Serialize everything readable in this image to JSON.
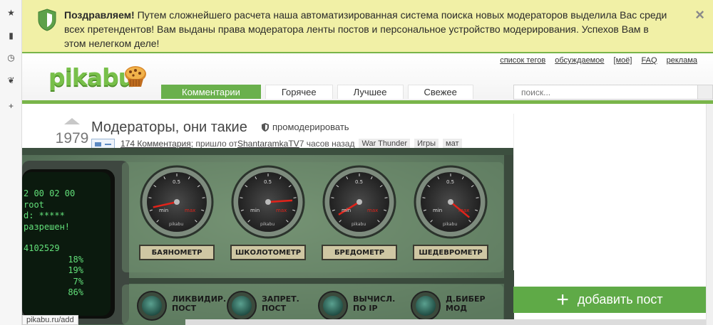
{
  "notice": {
    "title": "Поздравляем!",
    "text": " Путем сложнейшего расчета наша автоматизированная система поиска новых модераторов выделила Вас среди всех претендентов! Вам выданы права модератора ленты постов и персональное устройство модерирования. Успехов Вам в этом нелегком деле!",
    "close_icon": "×"
  },
  "header": {
    "logo_text": "pikabu",
    "links": [
      "список тегов",
      "обсуждаемое",
      "[моё]",
      "FAQ",
      "реклама"
    ],
    "tabs": [
      {
        "label": "Комментарии",
        "active": true
      },
      {
        "label": "Горячее",
        "active": false
      },
      {
        "label": "Лучшее",
        "active": false
      },
      {
        "label": "Свежее",
        "active": false
      }
    ],
    "search_placeholder": "поиск..."
  },
  "post": {
    "rating": "1979",
    "title": "Модераторы, они такие",
    "moderate_label": "промодерировать",
    "comments_link": "174 Комментария",
    "from_text": "; пришло от ",
    "author": "ShantaramkaTV",
    "time": " 7 часов назад",
    "tags": [
      "War Thunder",
      "Игры",
      "мат"
    ]
  },
  "device": {
    "screen_lines": [
      "2 00 02 00",
      "root",
      "d: *****",
      "разрешен!",
      "",
      "4102529",
      "18%",
      "19%",
      "7%",
      "86%"
    ],
    "gauges": [
      {
        "label": "БАЯНОМЕТР",
        "scale_top": "0.5",
        "min": "min",
        "max": "max",
        "brand": "pikabu",
        "level": 0.12
      },
      {
        "label": "ШКОЛОТОМЕТР",
        "scale_top": "0.5",
        "min": "min",
        "max": "max",
        "brand": "pikabu",
        "level": 0.82
      },
      {
        "label": "БРЕДОМЕТР",
        "scale_top": "0.5",
        "min": "min",
        "max": "max",
        "brand": "pikabu",
        "level": 0.05
      },
      {
        "label": "ШЕДЕВРОМЕТР",
        "scale_top": "0.5",
        "min": "min",
        "max": "max",
        "brand": "pikabu",
        "level": 0.98
      }
    ],
    "buttons": [
      {
        "line1": "ЛИКВИДИР.",
        "line2": "ПОСТ"
      },
      {
        "line1": "ЗАПРЕТ.",
        "line2": "ПОСТ"
      },
      {
        "line1": "ВЫЧИСЛ.",
        "line2": "ПО IP"
      },
      {
        "line1": "Д.БИБЕР",
        "line2": "МОД"
      }
    ]
  },
  "sidebar": {
    "add_post_label": "добавить пост",
    "add_post_icon": "+"
  },
  "statusbar": {
    "url": "pikabu.ru/add"
  },
  "rail": {
    "icons": [
      "★",
      "▮",
      "◷",
      "❦",
      "+"
    ]
  }
}
